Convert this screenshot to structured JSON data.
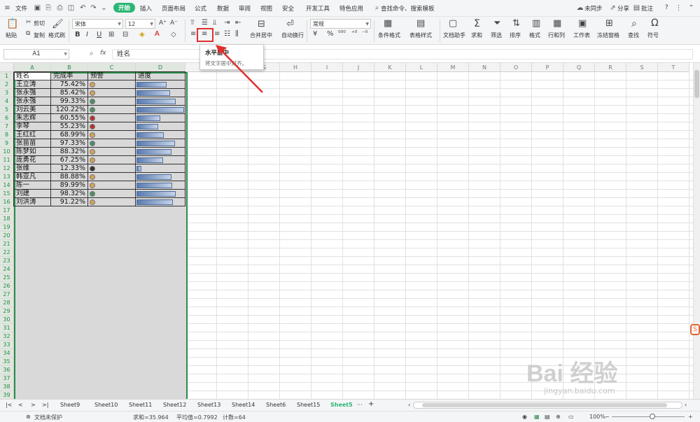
{
  "menubar": {
    "file": "文件",
    "tabs": [
      "开始",
      "插入",
      "页面布局",
      "公式",
      "数据",
      "审阅",
      "视图",
      "安全",
      "开发工具",
      "特色应用"
    ],
    "search": "查找命令、搜索模板",
    "sync": "未同步",
    "share": "分享",
    "comment": "批注",
    "help": "?"
  },
  "ribbon": {
    "paste": "粘贴",
    "cut": "剪切",
    "copy": "复制",
    "format_painter": "格式刷",
    "font_name": "宋体",
    "font_size": "12",
    "merge_center": "合并居中",
    "wrap_text": "自动换行",
    "number_format": "常规",
    "cond_format": "条件格式",
    "table_style": "表格样式",
    "doc_assistant": "文档助手",
    "sum": "求和",
    "filter": "筛选",
    "sort": "排序",
    "format": "格式",
    "rows_cols": "行和列",
    "worksheet": "工作表",
    "freeze": "冻结窗格",
    "find": "查找",
    "symbol": "符号"
  },
  "formula_bar": {
    "name_box": "A1",
    "fx": "fx",
    "content": "姓名"
  },
  "tooltip": {
    "title": "水平居中",
    "desc": "将文字居中对齐。"
  },
  "columns": [
    "A",
    "B",
    "C",
    "D",
    "E",
    "F",
    "G",
    "H",
    "I",
    "J",
    "K",
    "L",
    "M",
    "N",
    "O",
    "P",
    "Q",
    "R",
    "S",
    "T"
  ],
  "rows": [
    "1",
    "2",
    "3",
    "4",
    "5",
    "6",
    "7",
    "8",
    "9",
    "10",
    "11",
    "12",
    "13",
    "14",
    "15",
    "16",
    "17",
    "18",
    "19",
    "20",
    "21",
    "22",
    "23",
    "24",
    "25",
    "26",
    "27",
    "28",
    "29",
    "30",
    "31",
    "32",
    "33",
    "34",
    "35",
    "36",
    "37",
    "38",
    "39"
  ],
  "headers": [
    "姓名",
    "完成率",
    "预警",
    "进度"
  ],
  "table": [
    {
      "name": "王立涛",
      "rate": "75.42%",
      "value": 0.7542,
      "color": "#d4a25a"
    },
    {
      "name": "张永强",
      "rate": "85.42%",
      "value": 0.8542,
      "color": "#d4a25a"
    },
    {
      "name": "张永强",
      "rate": "99.33%",
      "value": 0.9933,
      "color": "#4a8f68"
    },
    {
      "name": "刘云美",
      "rate": "120.22%",
      "value": 1.2022,
      "color": "#4a8f68"
    },
    {
      "name": "朱志辉",
      "rate": "60.55%",
      "value": 0.6055,
      "color": "#b3362c"
    },
    {
      "name": "李琴",
      "rate": "55.23%",
      "value": 0.5523,
      "color": "#b3362c"
    },
    {
      "name": "王红红",
      "rate": "68.99%",
      "value": 0.6899,
      "color": "#d4a25a"
    },
    {
      "name": "张苗苗",
      "rate": "97.33%",
      "value": 0.9733,
      "color": "#4a8f68"
    },
    {
      "name": "陈梦如",
      "rate": "88.32%",
      "value": 0.8832,
      "color": "#d4a25a"
    },
    {
      "name": "庞勇花",
      "rate": "67.25%",
      "value": 0.6725,
      "color": "#d4a25a"
    },
    {
      "name": "张维",
      "rate": "12.33%",
      "value": 0.1233,
      "color": "#333333"
    },
    {
      "name": "韩亚凡",
      "rate": "88.88%",
      "value": 0.8888,
      "color": "#d4a25a"
    },
    {
      "name": "陈一",
      "rate": "89.99%",
      "value": 0.8999,
      "color": "#d4a25a"
    },
    {
      "name": "刘建",
      "rate": "98.32%",
      "value": 0.9832,
      "color": "#4a8f68"
    },
    {
      "name": "刘洪涛",
      "rate": "91.22%",
      "value": 0.9122,
      "color": "#d4a25a"
    }
  ],
  "sheets": [
    "Sheet9",
    "Sheet10",
    "Sheet11",
    "Sheet12",
    "Sheet13",
    "Sheet14",
    "Sheet6",
    "Sheet15",
    "Sheet5"
  ],
  "active_sheet": "Sheet5",
  "status": {
    "protect": "文档未保护",
    "sum": "求和=35.964",
    "avg": "平均值=0.7992",
    "count": "计数=64",
    "zoom": "100%"
  },
  "watermark": {
    "text": "Bai 经验",
    "url": "jingyan.baidu.com"
  },
  "colors": {
    "accent": "#2bb673",
    "selection": "#2b8a4b",
    "annotation": "#e0302e"
  }
}
